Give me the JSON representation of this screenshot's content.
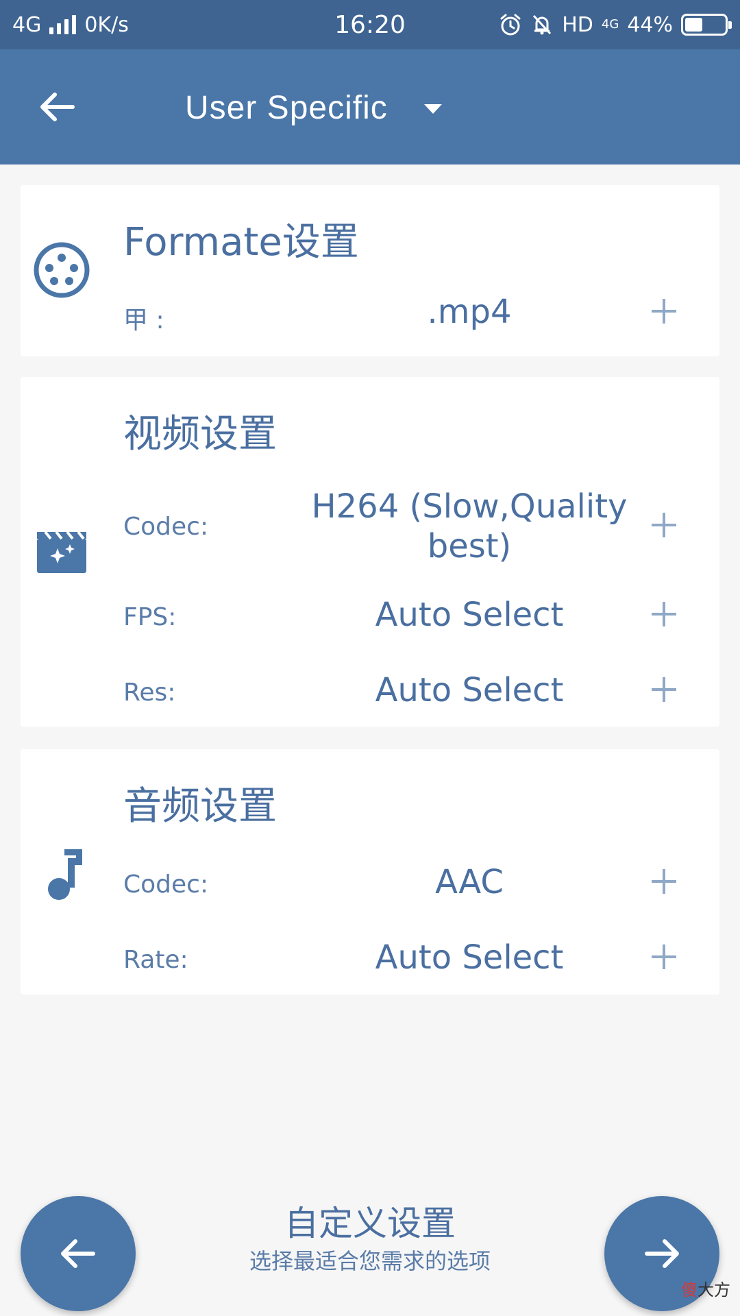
{
  "status_bar": {
    "network": "4G",
    "speed": "0K/s",
    "time": "16:20",
    "hd": "HD",
    "data_type": "4G",
    "battery": "44%",
    "battery_level": 0.44
  },
  "app_bar": {
    "title": "User Specific"
  },
  "format_card": {
    "title": "Formate设置",
    "rows": [
      {
        "label": "甲 :",
        "value": ".mp4"
      }
    ]
  },
  "video_card": {
    "title": "视频设置",
    "rows": [
      {
        "label": "Codec:",
        "value": "H264 (Slow,Quality best)"
      },
      {
        "label": "FPS:",
        "value": "Auto Select"
      },
      {
        "label": "Res:",
        "value": "Auto Select"
      }
    ]
  },
  "audio_card": {
    "title": "音频设置",
    "rows": [
      {
        "label": "Codec:",
        "value": "AAC"
      },
      {
        "label": "Rate:",
        "value": "Auto Select"
      }
    ]
  },
  "footer": {
    "title": "自定义设置",
    "subtitle": "选择最适合您需求的选项"
  },
  "watermark": {
    "first_char": "傻",
    "rest": "大方"
  },
  "colors": {
    "status_bar": "#3f6491",
    "app_bar": "#4a76a8",
    "accent": "#4a6fa0",
    "plus": "#8fa8c6",
    "background": "#f6f6f6"
  }
}
